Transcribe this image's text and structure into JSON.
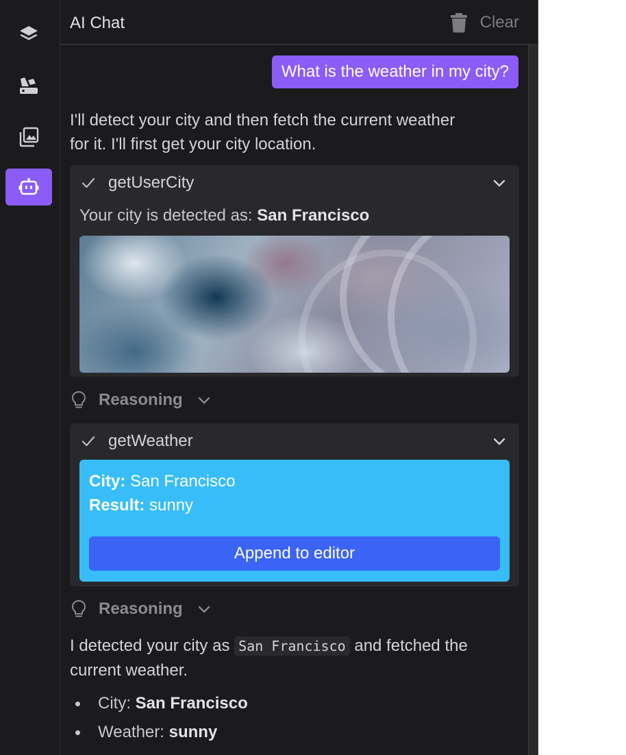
{
  "window": {
    "title": "AI Chat"
  },
  "rail": {
    "items": [
      {
        "icon": "layers-icon",
        "active": false
      },
      {
        "icon": "shapes-icon",
        "active": false
      },
      {
        "icon": "gallery-icon",
        "active": false
      },
      {
        "icon": "robot-icon",
        "active": true
      }
    ]
  },
  "header": {
    "clear_label": "Clear",
    "clear_icon": "trash-icon"
  },
  "chat": {
    "user_message": "What is the weather in my city?",
    "intro_line1": "I'll detect your city and then fetch the current weather",
    "intro_line2": "for it. I'll first get your city location.",
    "tool_city": {
      "name": "getUserCity",
      "result_prefix": "Your city is detected as:",
      "city": "San Francisco"
    },
    "reasoning_label": "Reasoning",
    "tool_weather": {
      "name": "getWeather",
      "city_label": "City:",
      "city_value": "San Francisco",
      "result_label": "Result:",
      "result_value": "sunny",
      "button_label": "Append to editor"
    },
    "summary": {
      "part1": "I detected your city as",
      "code": "San Francisco",
      "part2": "and fetched the",
      "line2": "current weather."
    },
    "bullets": [
      {
        "label": "City:",
        "value": "San Francisco"
      },
      {
        "label": "Weather:",
        "value": "sunny"
      }
    ]
  },
  "colors": {
    "accent": "#8b5cf6",
    "result_bg": "#38bdf8",
    "button_bg": "#3b63f5",
    "panel_bg": "#1b1b1d"
  }
}
